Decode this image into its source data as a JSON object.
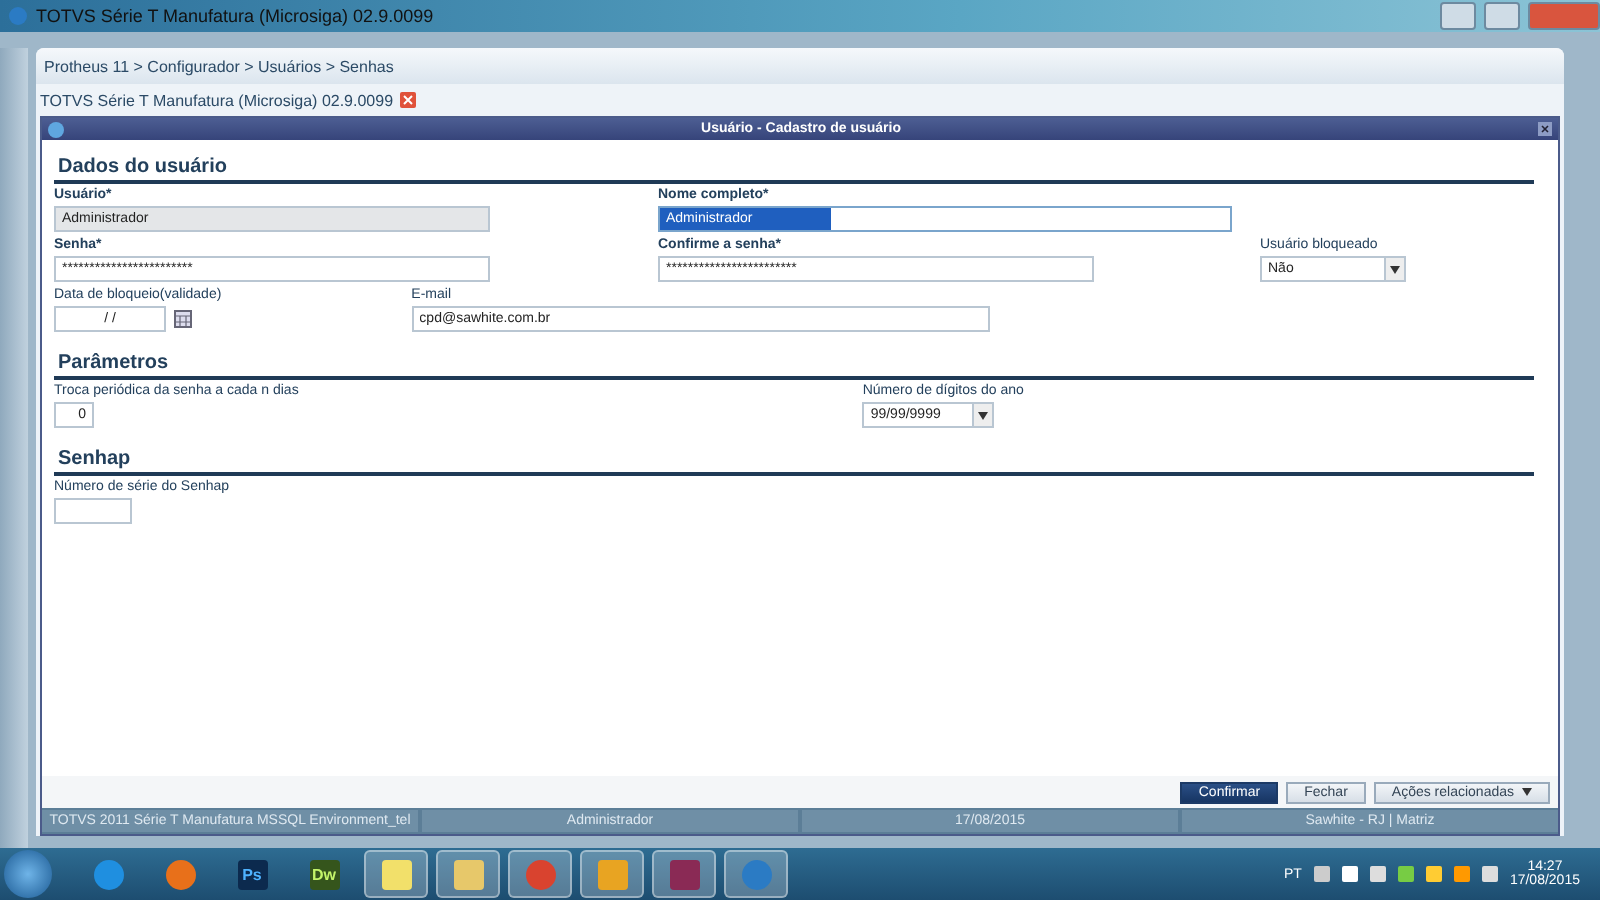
{
  "window": {
    "title": "TOTVS Série T Manufatura (Microsiga) 02.9.0099"
  },
  "breadcrumb": "Protheus 11 > Configurador > Usuários > Senhas",
  "tab": {
    "label": "TOTVS Série T Manufatura (Microsiga) 02.9.0099"
  },
  "dialog": {
    "title": "Usuário - Cadastro de usuário"
  },
  "sections": [
    {
      "title": "Dados do usuário",
      "rows": [
        [
          {
            "kind": "text",
            "label": "Usuário*",
            "required": true,
            "value": "Administrador",
            "disabled": true,
            "text_selected": false
          },
          {
            "kind": "text",
            "label": "Nome completo*",
            "required": true,
            "value": "Administrador",
            "disabled": false,
            "text_selected": true
          }
        ],
        [
          {
            "kind": "text",
            "label": "Senha*",
            "required": true,
            "value": "************************",
            "disabled": false,
            "text_selected": false
          },
          {
            "kind": "text",
            "label": "Confirme a senha*",
            "required": true,
            "value": "************************",
            "disabled": false,
            "text_selected": false
          },
          {
            "kind": "select",
            "label": "Usuário bloqueado",
            "required": false,
            "value": "Não"
          }
        ],
        [
          {
            "kind": "date",
            "label": "Data de bloqueio(validade)",
            "required": false,
            "value": "/ /"
          },
          {
            "kind": "text",
            "label": "E-mail",
            "required": false,
            "value": "cpd@sawhite.com.br",
            "disabled": false,
            "text_selected": false
          }
        ]
      ]
    },
    {
      "title": "Parâmetros",
      "rows": [
        [
          {
            "kind": "number",
            "label": "Troca periódica da senha a cada n dias",
            "required": false,
            "value": "0"
          },
          {
            "kind": "select",
            "label": "Número de dígitos do ano",
            "required": false,
            "value": "99/99/9999"
          }
        ]
      ]
    },
    {
      "title": "Senhap",
      "rows": [
        [
          {
            "kind": "text",
            "label": "Número de série do Senhap",
            "required": false,
            "disabled": false,
            "text_selected": false
          }
        ]
      ]
    }
  ],
  "buttons": [
    {
      "label": "Confirmar",
      "kind": "primary"
    },
    {
      "label": "Fechar",
      "kind": "plain"
    },
    {
      "label": "Ações relacionadas",
      "kind": "menu"
    }
  ],
  "status_bar": [
    "TOTVS 2011 Série T Manufatura MSSQL Environment_tel",
    "Administrador",
    "17/08/2015",
    "Sawhite - RJ | Matriz"
  ],
  "taskbar": {
    "apps": [
      {
        "kind": "ie",
        "running": false
      },
      {
        "kind": "firefox",
        "running": false
      },
      {
        "kind": "ps",
        "label": "Ps",
        "running": false
      },
      {
        "kind": "dw",
        "label": "Dw",
        "running": false
      },
      {
        "kind": "notes",
        "running": true
      },
      {
        "kind": "explorer",
        "running": true
      },
      {
        "kind": "chrome",
        "running": true
      },
      {
        "kind": "outlook",
        "running": true
      },
      {
        "kind": "winrar",
        "running": true
      },
      {
        "kind": "app",
        "running": true
      }
    ],
    "language": "PT",
    "time": "14:27",
    "date": "17/08/2015"
  }
}
